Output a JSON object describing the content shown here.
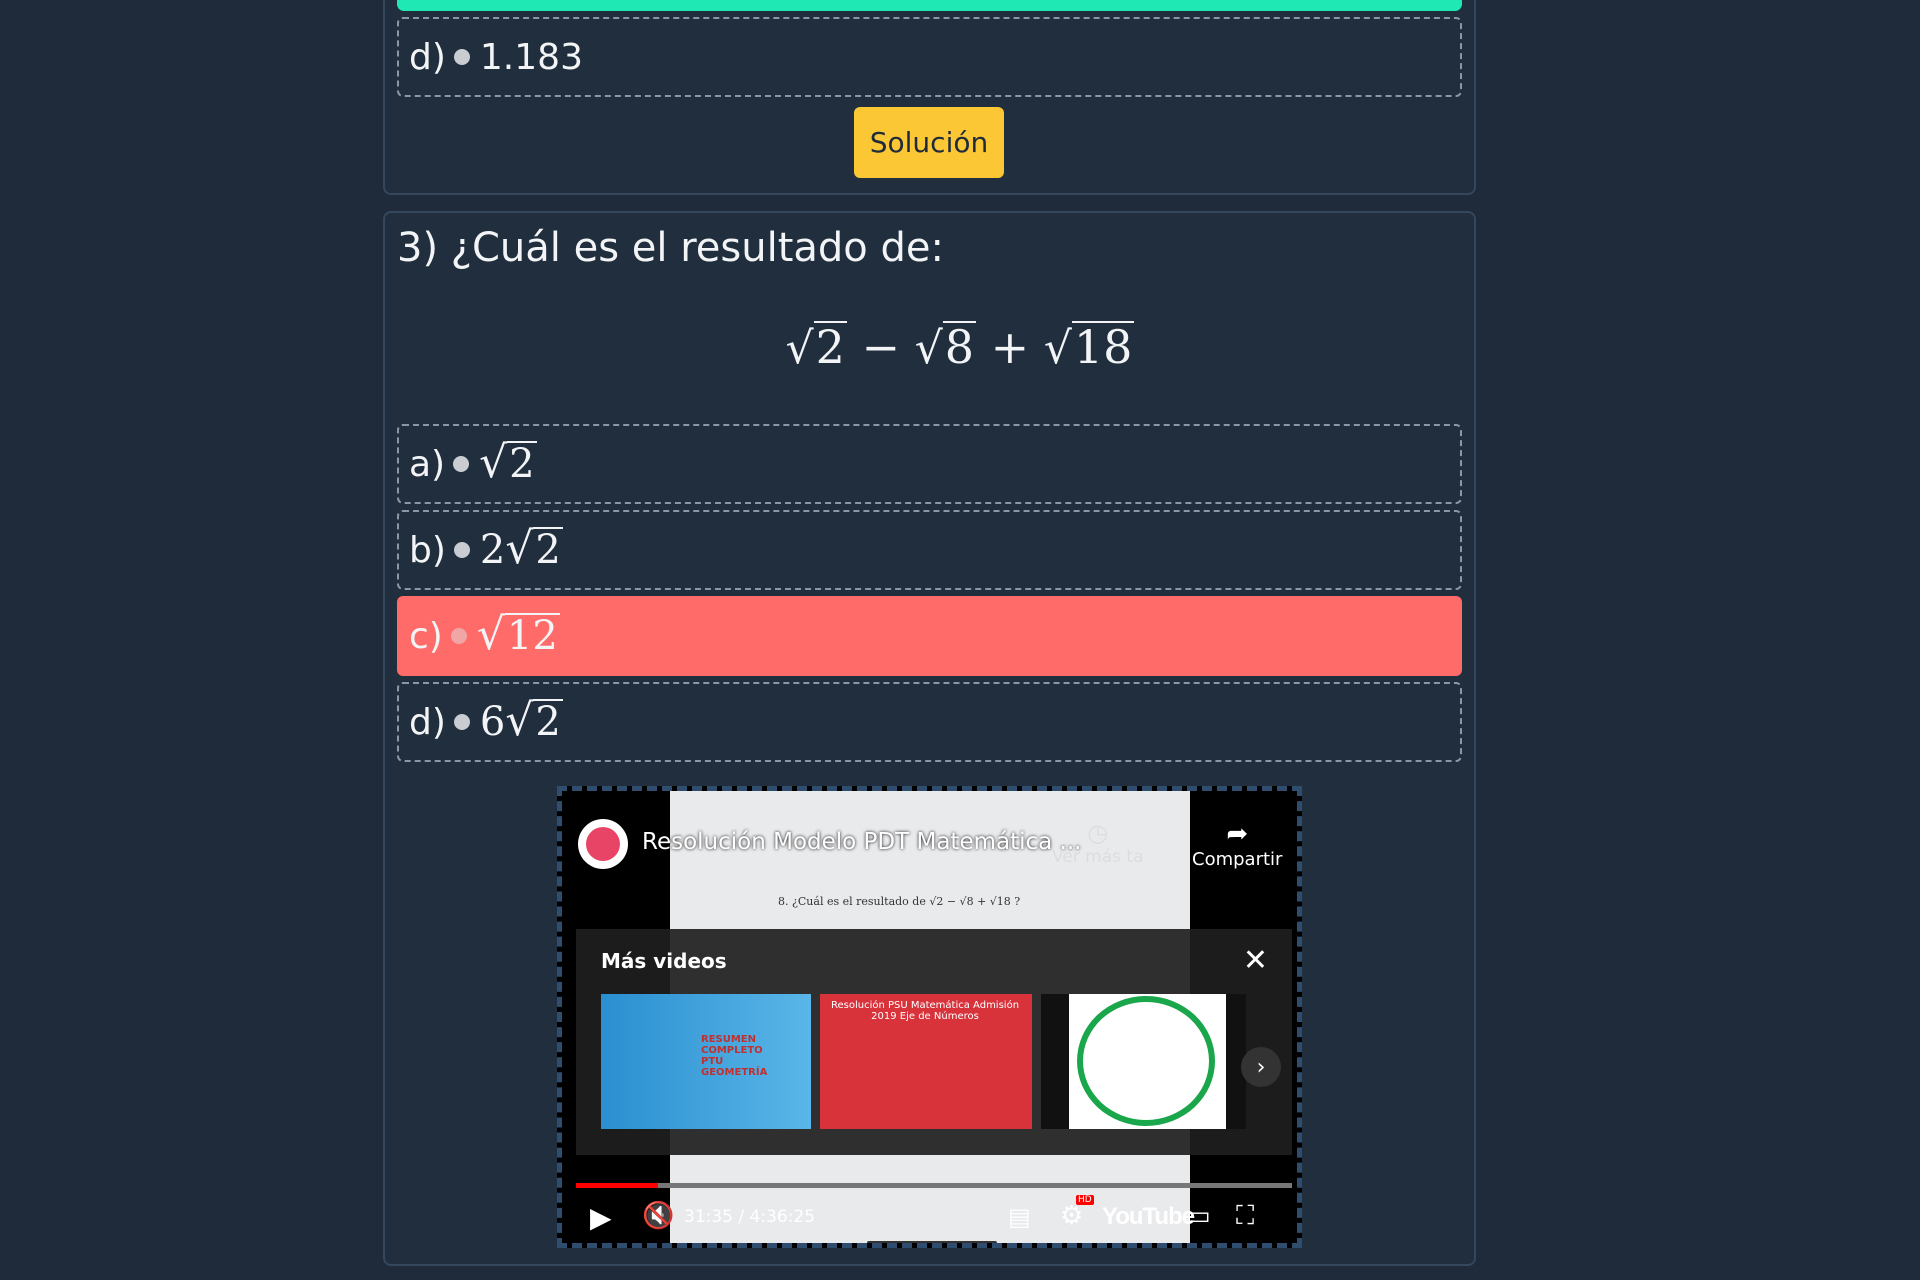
{
  "previous_question": {
    "option_d": {
      "letter": "d)",
      "value": "1.183"
    },
    "solution_label": "Solución"
  },
  "question3": {
    "title": "3) ¿Cuál es el resultado de:",
    "formula": {
      "a": "2",
      "b": "8",
      "c": "18",
      "minus": "−",
      "plus": "+"
    },
    "options": [
      {
        "letter": "a)",
        "coef": "",
        "radicand": "2"
      },
      {
        "letter": "b)",
        "coef": "2",
        "radicand": "2"
      },
      {
        "letter": "c)",
        "coef": "",
        "radicand": "12",
        "selected": true
      },
      {
        "letter": "d)",
        "coef": "6",
        "radicand": "2"
      }
    ]
  },
  "video": {
    "title": "Resolución Modelo PDT Matemática ...",
    "watch_later": "Ver más ta",
    "share": "Compartir",
    "page_question": "8.   ¿Cuál es el resultado de √2 − √8 + √18 ?",
    "more_videos": "Más videos",
    "thumbs": [
      {
        "text": "RESUMEN COMPLETO PTU GEOMETRÍA"
      },
      {
        "text": "Resolución PSU Matemática Admisión 2019 Eje de Números"
      },
      {
        "text": ""
      }
    ],
    "time": "31:35 / 4:36:25",
    "progress": 0.114,
    "youtube": "YouTube",
    "hd_badge": "HD"
  },
  "colors": {
    "accent_bar": "#1fe8b4",
    "button": "#fbc734",
    "selected": "#ff6b69",
    "bg": "#1f2b3a"
  }
}
